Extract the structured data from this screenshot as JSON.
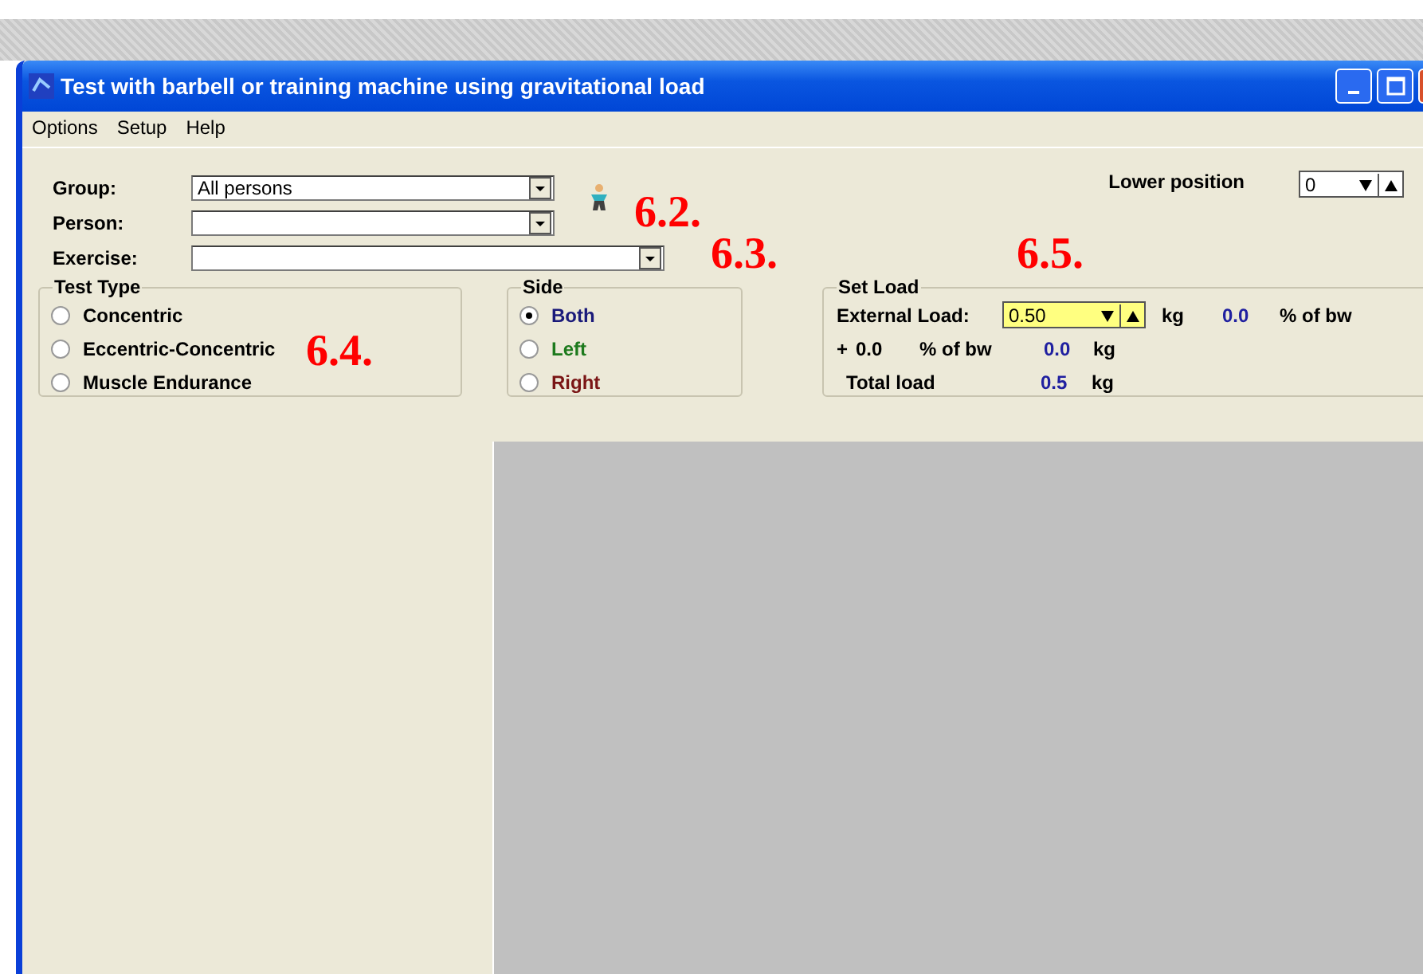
{
  "window": {
    "title": "Test with barbell or training machine using gravitational load"
  },
  "menu": [
    "Options",
    "Setup",
    "Help"
  ],
  "fields": [
    {
      "label": "Group:",
      "value": "All persons",
      "kind": "short"
    },
    {
      "label": "Person:",
      "kind": "short"
    },
    {
      "label": "Exercise:",
      "kind": "long"
    }
  ],
  "lower_position": {
    "label": "Lower position",
    "value": "0"
  },
  "test_type": {
    "title": "Test Type",
    "options": [
      {
        "label": "Concentric",
        "selected": false
      },
      {
        "label": "Eccentric-Concentric",
        "selected": false
      },
      {
        "label": "Muscle Endurance",
        "selected": false
      }
    ]
  },
  "side": {
    "title": "Side",
    "options": [
      {
        "label": "Both",
        "selected": true,
        "color": "#1a1a7a"
      },
      {
        "label": "Left",
        "selected": false,
        "color": "#1d7a1d"
      },
      {
        "label": "Right",
        "selected": false,
        "color": "#7a1515"
      }
    ]
  },
  "set_load": {
    "title": "Set Load",
    "external_label": "External Load:",
    "external_value": "0.50",
    "external_unit": "kg",
    "bw_value": "0.0",
    "bw_unit": "% of bw",
    "plus": "+",
    "plus_value": "0.0",
    "plus_unit": "% of bw",
    "plus_kg": "0.0",
    "plus_kg_unit": "kg",
    "total_label": "Total load",
    "total_value": "0.5",
    "total_unit": "kg"
  },
  "annotations": [
    "6.2.",
    "6.3.",
    "6.4.",
    "6.5."
  ]
}
